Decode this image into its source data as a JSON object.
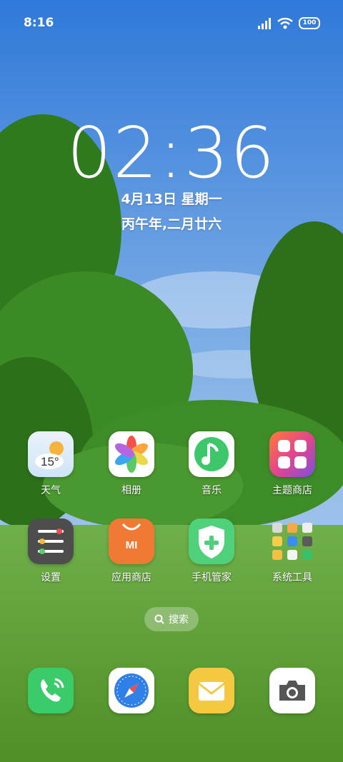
{
  "status_bar": {
    "time": "8:16",
    "battery": "100"
  },
  "lockscreen": {
    "clock": "02:36",
    "date": "4月13日 星期一",
    "lunar": "丙午年,二月廿六"
  },
  "apps": [
    {
      "label": "天气",
      "icon": "weather-icon",
      "temp": "15°"
    },
    {
      "label": "相册",
      "icon": "gallery-icon"
    },
    {
      "label": "音乐",
      "icon": "music-icon"
    },
    {
      "label": "主题商店",
      "icon": "theme-store-icon"
    },
    {
      "label": "设置",
      "icon": "settings-icon"
    },
    {
      "label": "应用商店",
      "icon": "app-store-icon",
      "text": "MI"
    },
    {
      "label": "手机管家",
      "icon": "security-icon"
    },
    {
      "label": "系统工具",
      "icon": "folder-icon"
    }
  ],
  "search": {
    "label": "搜索"
  },
  "dock": [
    {
      "icon": "phone-icon"
    },
    {
      "icon": "browser-icon"
    },
    {
      "icon": "mail-icon"
    },
    {
      "icon": "camera-icon"
    }
  ],
  "colors": {
    "sky_top": "#2f79d9",
    "sky_bottom": "#9fc4ea",
    "grass": "#63a33a",
    "tree": "#2f7a1c"
  }
}
